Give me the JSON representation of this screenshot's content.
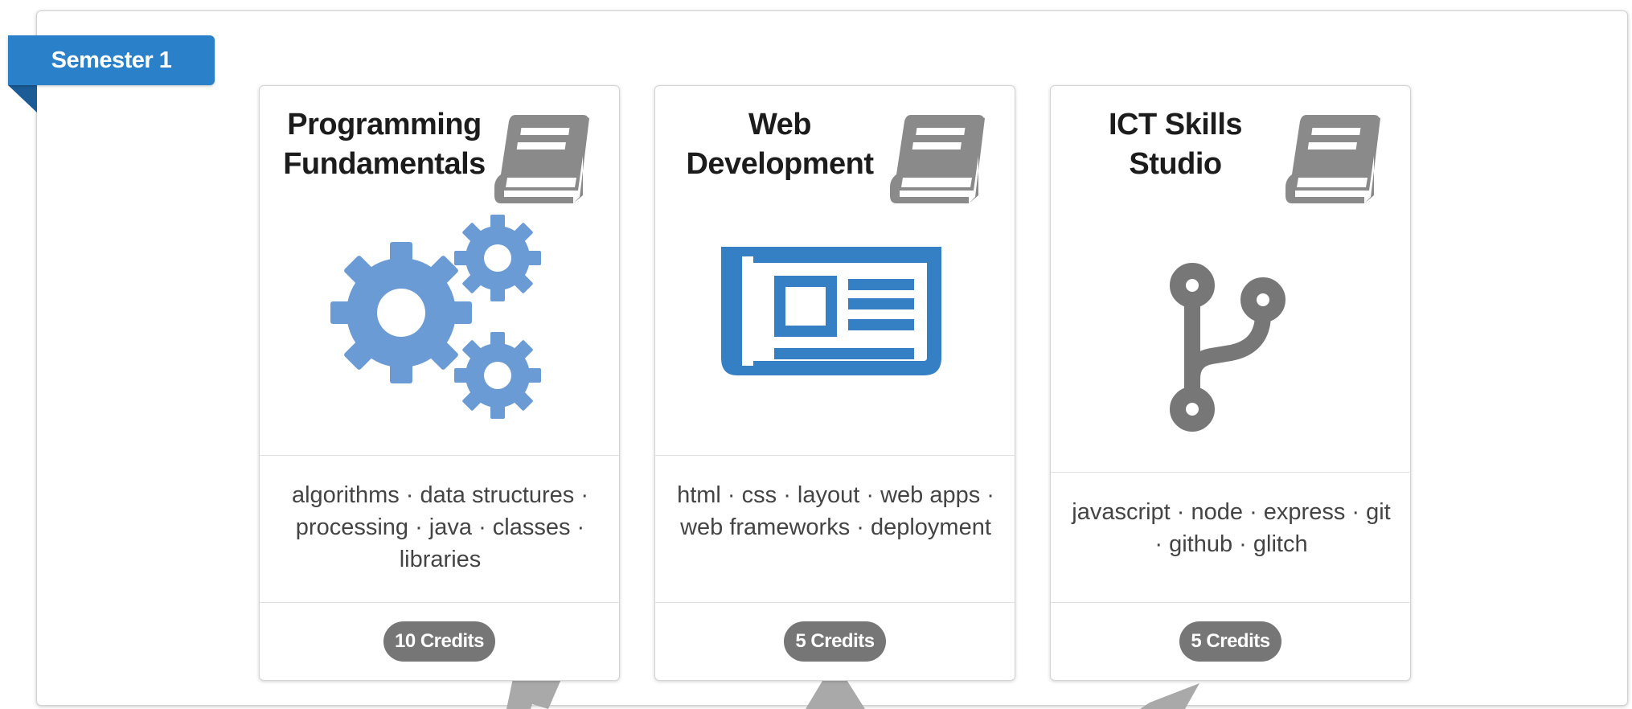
{
  "semester": {
    "label": "Semester 1"
  },
  "colors": {
    "accent": "#2a80c9",
    "icon_blue": "#6a9bd5",
    "icon_blue_dark": "#3580c5",
    "icon_gray": "#777777",
    "badge_gray": "#767676"
  },
  "cards": [
    {
      "title_line1": "Programming",
      "title_line2": "Fundamentals",
      "header_icon": "book-icon",
      "image_icon": "cogs-icon",
      "description": "algorithms · data structures · processing · java · classes · libraries",
      "credits": "10 Credits"
    },
    {
      "title_line1": "Web",
      "title_line2": "Development",
      "header_icon": "book-icon",
      "image_icon": "newspaper-icon",
      "description": "html · css · layout · web apps · web frameworks · deployment",
      "credits": "5 Credits"
    },
    {
      "title_line1": "ICT Skills",
      "title_line2": "Studio",
      "header_icon": "book-icon",
      "image_icon": "code-fork-icon",
      "description": "javascript · node · express · git · github · glitch",
      "credits": "5 Credits"
    }
  ]
}
